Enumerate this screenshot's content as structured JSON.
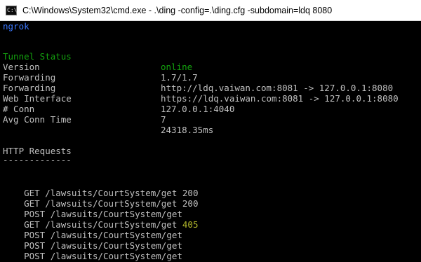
{
  "window": {
    "icon_label": "C:\\",
    "title": "C:\\Windows\\System32\\cmd.exe - .\\ding  -config=.\\ding.cfg -subdomain=ldq 8080"
  },
  "console": {
    "app_name": "ngrok",
    "status_rows": [
      {
        "key": "Tunnel Status",
        "value": "online"
      },
      {
        "key": "Version",
        "value": "1.7/1.7"
      },
      {
        "key": "Forwarding",
        "value": "http://ldq.vaiwan.com:8081 -> 127.0.0.1:8080"
      },
      {
        "key": "Forwarding",
        "value": "https://ldq.vaiwan.com:8081 -> 127.0.0.1:8080"
      },
      {
        "key": "Web Interface",
        "value": "127.0.0.1:4040"
      },
      {
        "key": "# Conn",
        "value": "7"
      },
      {
        "key": "Avg Conn Time",
        "value": "24318.35ms"
      }
    ],
    "requests_header": "HTTP Requests",
    "requests_rule": "-------------",
    "requests": [
      {
        "method": "GET",
        "path": "/lawsuits/CourtSystem/get",
        "status": "200"
      },
      {
        "method": "GET",
        "path": "/lawsuits/CourtSystem/get",
        "status": "200"
      },
      {
        "method": "POST",
        "path": "/lawsuits/CourtSystem/get",
        "status": ""
      },
      {
        "method": "GET",
        "path": "/lawsuits/CourtSystem/get",
        "status": "405"
      },
      {
        "method": "POST",
        "path": "/lawsuits/CourtSystem/get",
        "status": ""
      },
      {
        "method": "POST",
        "path": "/lawsuits/CourtSystem/get",
        "status": ""
      },
      {
        "method": "POST",
        "path": "/lawsuits/CourtSystem/get",
        "status": ""
      }
    ]
  },
  "colors": {
    "background": "#000000",
    "ngrok_blue": "#3b78ff",
    "status_green": "#13a10e",
    "text_gray": "#c0c0c0",
    "status_405": "#b5ba2c"
  }
}
